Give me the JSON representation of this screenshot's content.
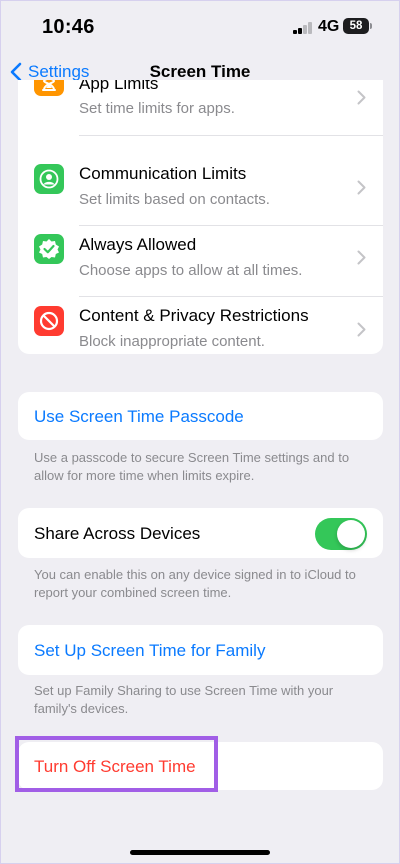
{
  "status_bar": {
    "time": "10:46",
    "network": "4G",
    "battery": "58"
  },
  "nav": {
    "back_label": "Settings",
    "title": "Screen Time"
  },
  "limits": [
    {
      "title": "App Limits",
      "subtitle": "Set time limits for apps.",
      "icon": "hourglass-icon",
      "color": "#ff9500"
    },
    {
      "title": "Communication Limits",
      "subtitle": "Set limits based on contacts.",
      "icon": "person-circle-icon",
      "color": "#34c759"
    },
    {
      "title": "Always Allowed",
      "subtitle": "Choose apps to allow at all times.",
      "icon": "checkmark-seal-icon",
      "color": "#34c759"
    },
    {
      "title": "Content & Privacy Restrictions",
      "subtitle": "Block inappropriate content.",
      "icon": "no-entry-icon",
      "color": "#ff3b30"
    }
  ],
  "passcode": {
    "label": "Use Screen Time Passcode",
    "footnote": "Use a passcode to secure Screen Time settings and to allow for more time when limits expire."
  },
  "share": {
    "label": "Share Across Devices",
    "enabled": true,
    "footnote": "You can enable this on any device signed in to iCloud to report your combined screen time."
  },
  "family": {
    "label": "Set Up Screen Time for Family",
    "footnote": "Set up Family Sharing to use Screen Time with your family's devices."
  },
  "turn_off": {
    "label": "Turn Off Screen Time"
  },
  "colors": {
    "accent_blue": "#0a7aff",
    "destructive_red": "#ff3b30",
    "toggle_green": "#34c759",
    "highlight_purple": "#a15ee6"
  }
}
